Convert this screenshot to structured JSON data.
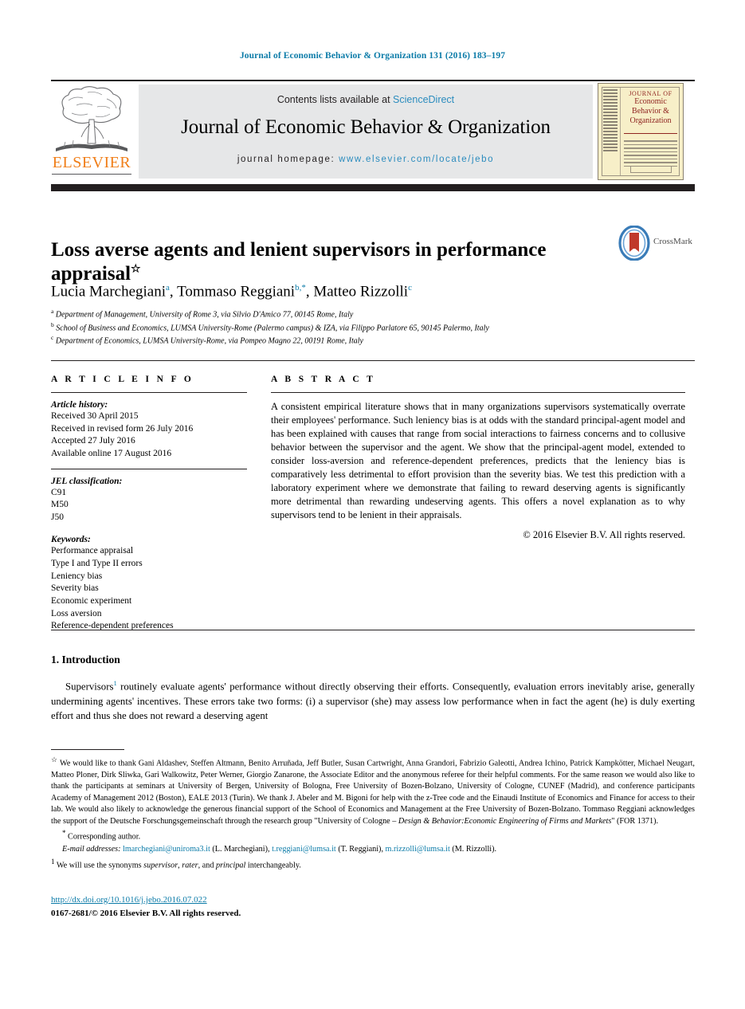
{
  "running_head": "Journal of Economic Behavior & Organization 131 (2016) 183–197",
  "masthead": {
    "publisher_name": "ELSEVIER",
    "contents_prefix": "Contents lists available at ",
    "contents_link": "ScienceDirect",
    "journal_title": "Journal of Economic Behavior & Organization",
    "homepage_prefix": "journal homepage: ",
    "homepage_url": "www.elsevier.com/locate/jebo",
    "cover": {
      "line1": "JOURNAL OF",
      "line2": "Economic",
      "line3": "Behavior &",
      "line4": "Organization"
    }
  },
  "article": {
    "title": "Loss averse agents and lenient supervisors in performance appraisal",
    "title_mark": "☆",
    "crossmark_label": "CrossMark",
    "authors": [
      {
        "name": "Lucia Marchegiani",
        "mark": "a",
        "sep": ", "
      },
      {
        "name": "Tommaso Reggiani",
        "mark": "b,*",
        "sep": ", "
      },
      {
        "name": "Matteo Rizzolli",
        "mark": "c",
        "sep": ""
      }
    ],
    "affiliations": [
      {
        "mark": "a",
        "text": "Department of Management, University of Rome 3, via Silvio D'Amico 77, 00145 Rome, Italy"
      },
      {
        "mark": "b",
        "text": "School of Business and Economics, LUMSA University-Rome (Palermo campus) & IZA, via Filippo Parlatore 65, 90145 Palermo, Italy"
      },
      {
        "mark": "c",
        "text": "Department of Economics, LUMSA University-Rome, via Pompeo Magno 22, 00191 Rome, Italy"
      }
    ]
  },
  "article_info": {
    "heading": "A R T I C L E    I N F O",
    "history_label": "Article history:",
    "history": [
      "Received 30 April 2015",
      "Received in revised form 26 July 2016",
      "Accepted 27 July 2016",
      "Available online 17 August 2016"
    ],
    "jel_label": "JEL classification:",
    "jel_codes": [
      "C91",
      "M50",
      "J50"
    ],
    "keywords_label": "Keywords:",
    "keywords": [
      "Performance appraisal",
      "Type I and Type II errors",
      "Leniency bias",
      "Severity bias",
      "Economic experiment",
      "Loss aversion",
      "Reference-dependent preferences"
    ]
  },
  "abstract": {
    "heading": "A B S T R A C T",
    "text": "A consistent empirical literature shows that in many organizations supervisors systematically overrate their employees' performance. Such leniency bias is at odds with the standard principal-agent model and has been explained with causes that range from social interactions to fairness concerns and to collusive behavior between the supervisor and the agent. We show that the principal-agent model, extended to consider loss-aversion and reference-dependent preferences, predicts that the leniency bias is comparatively less detrimental to effort provision than the severity bias. We test this prediction with a laboratory experiment where we demonstrate that failing to reward deserving agents is significantly more detrimental than rewarding undeserving agents. This offers a novel explanation as to why supervisors tend to be lenient in their appraisals.",
    "copyright": "© 2016 Elsevier B.V. All rights reserved."
  },
  "introduction": {
    "heading": "1.  Introduction",
    "para_part1": "Supervisors",
    "footnote_marker": "1",
    "para_part2": " routinely evaluate agents' performance without directly observing their efforts. Consequently, evaluation errors inevitably arise, generally undermining agents' incentives. These errors take two forms: (i) a supervisor (she) may assess low performance when in fact the agent (he) is duly exerting effort and thus she does not reward a deserving agent"
  },
  "footnotes": {
    "star_marker": "☆",
    "acknowledgement": "We would like to thank Gani Aldashev, Steffen Altmann, Benito Arruñada, Jeff Butler, Susan Cartwright, Anna Grandori, Fabrizio Galeotti, Andrea Ichino, Patrick Kampkötter, Michael Neugart, Matteo Ploner, Dirk Sliwka, Gari Walkowitz, Peter Werner, Giorgio Zanarone, the Associate Editor and the anonymous referee for their helpful comments. For the same reason we would also like to thank the participants at seminars at University of Bergen, University of Bologna, Free University of Bozen-Bolzano, University of Cologne, CUNEF (Madrid), and conference participants Academy of Management 2012 (Boston), EALE 2013 (Turin). We thank J. Abeler and M. Bigoni for help with the z-Tree code and the Einaudi Institute of Economics and Finance for access to their lab. We would also likely to acknowledge the generous financial support of the School of Economics and Management at the Free University of Bozen-Bolzano. Tommaso Reggiani acknowledges the support of the Deutsche Forschungsgemeinschaft through the research group \"University of Cologne – ",
    "acknowledgement_italic": "Design & Behavior:Economic Engineering of Firms and Markets",
    "acknowledgement_tail": "\" (FOR 1371).",
    "corresponding_marker": "*",
    "corresponding_author": "Corresponding author.",
    "email_label": "E-mail addresses:",
    "emails": [
      {
        "address": "lmarchegiani@uniroma3.it",
        "owner": " (L. Marchegiani), "
      },
      {
        "address": "t.reggiani@lumsa.it",
        "owner": " (T. Reggiani), "
      },
      {
        "address": "m.rizzolli@lumsa.it",
        "owner": " (M. Rizzolli)."
      }
    ],
    "note1_marker": "1",
    "note1_part1": "We will use the synonyms ",
    "note1_italic1": "supervisor",
    "note1_part2": ", ",
    "note1_italic2": "rater",
    "note1_part3": ", and ",
    "note1_italic3": "principal",
    "note1_part4": " interchangeably."
  },
  "footer": {
    "doi": "http://dx.doi.org/10.1016/j.jebo.2016.07.022",
    "issn": "0167-2681/© 2016 Elsevier B.V. All rights reserved."
  },
  "colors": {
    "accent_blue": "#0b7ba8",
    "link_blue": "#2b8cbe",
    "elsevier_orange": "#f07f1a",
    "cover_red": "#8f2420",
    "rule_black": "#231f20"
  }
}
